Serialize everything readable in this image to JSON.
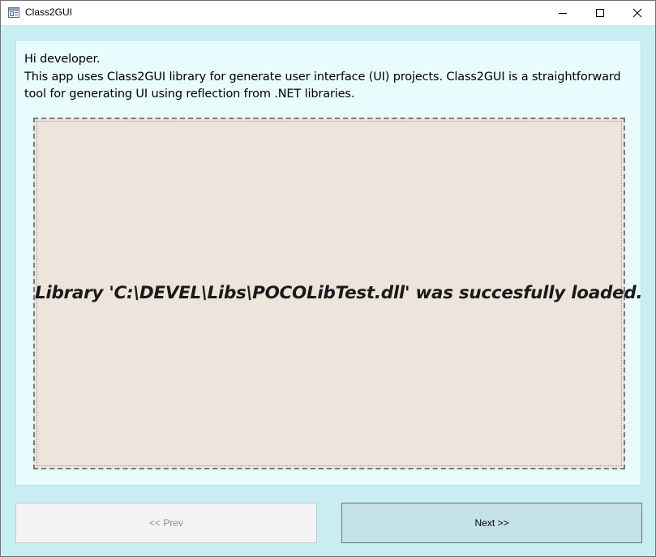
{
  "window": {
    "title": "Class2GUI"
  },
  "intro": {
    "greeting": "Hi developer.",
    "description": "This app uses Class2GUI library for generate user interface (UI) projects. Class2GUI is a straightforward tool for generating UI using reflection from .NET libraries."
  },
  "status": {
    "message": "Library 'C:\\DEVEL\\Libs\\POCOLibTest.dll' was succesfully loaded."
  },
  "navigation": {
    "prev_label": "<< Prev",
    "next_label": "Next >>"
  },
  "icons": {
    "app": "app-window-icon",
    "minimize": "minimize-icon",
    "maximize": "maximize-icon",
    "close": "close-icon"
  },
  "colors": {
    "window_bg": "#c8eef4",
    "panel_bg": "#e8fbfd",
    "message_bg": "#ede4db",
    "next_button_bg": "#c5e2e8",
    "prev_button_bg": "#f4f4f4"
  }
}
